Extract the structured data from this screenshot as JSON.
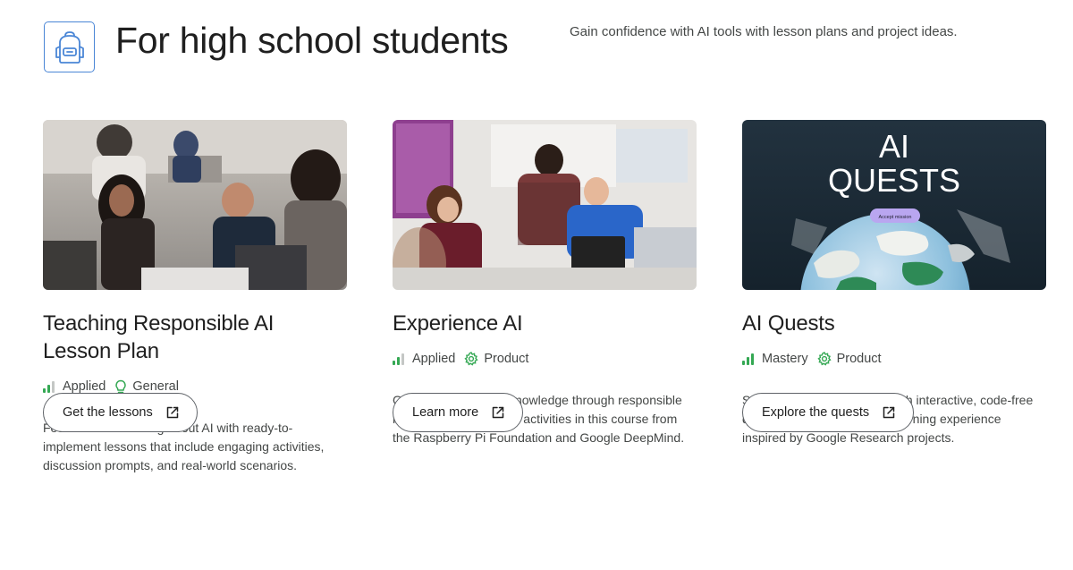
{
  "header": {
    "icon": "backpack-icon",
    "title": "For high school students",
    "description": "Gain confidence with AI tools with lesson plans and project ideas."
  },
  "cards": [
    {
      "image": "classroom-students-photo",
      "title": "Teaching Responsible AI Lesson Plan",
      "level": {
        "label": "Applied",
        "icon": "level-bars-icon"
      },
      "category": {
        "label": "General",
        "icon": "lightbulb-icon"
      },
      "description": "Foster critical thinking about AI with ready-to-implement lessons that include engaging activities, discussion prompts, and real-world scenarios.",
      "button": {
        "label": "Get the lessons",
        "icon": "open-in-new-icon"
      }
    },
    {
      "image": "teacher-helping-students-photo",
      "title": "Experience AI",
      "level": {
        "label": "Applied",
        "icon": "level-bars-icon"
      },
      "category": {
        "label": "Product",
        "icon": "gear-icon"
      },
      "description": "Gain foundational AI knowledge through responsible lessons and interactive activities in this course from the Raspberry Pi Foundation and Google DeepMind.",
      "button": {
        "label": "Learn more",
        "icon": "open-in-new-icon"
      }
    },
    {
      "image": "ai-quests-game-art",
      "image_text": {
        "line1": "AI",
        "line2": "QUESTS",
        "pill": "Accept mission"
      },
      "title": "AI Quests",
      "level": {
        "label": "Mastery",
        "icon": "level-bars-icon"
      },
      "category": {
        "label": "Product",
        "icon": "gear-icon"
      },
      "description": "Solve real-world problems with interactive, code-free quests in this game-based learning experience inspired by Google Research projects.",
      "button": {
        "label": "Explore the quests",
        "icon": "open-in-new-icon"
      }
    }
  ],
  "colors": {
    "accent_blue": "#4a86d6",
    "level_green": "#34a853",
    "level_gray": "#c4c7c5",
    "text_primary": "#1f1f1f",
    "text_secondary": "#444746",
    "button_border": "#5f6368"
  }
}
